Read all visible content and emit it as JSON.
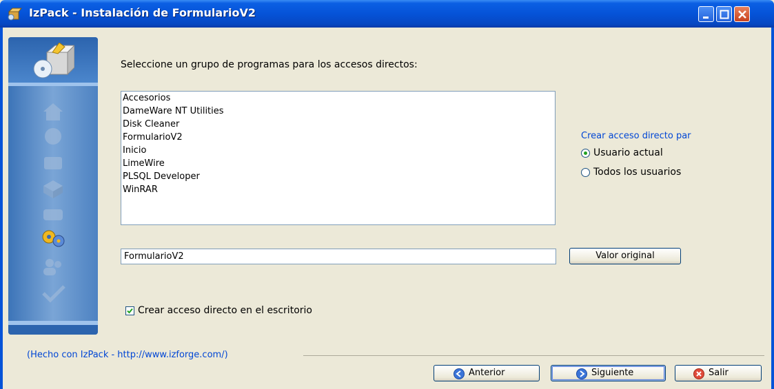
{
  "window": {
    "title": "IzPack - Instalación de FormularioV2",
    "icon": "setup-package-icon"
  },
  "main": {
    "prompt": "Seleccione un grupo de programas para los accesos directos:",
    "program_groups": [
      "Accesorios",
      "DameWare NT Utilities",
      "Disk Cleaner",
      "FormularioV2",
      "Inicio",
      "LimeWire",
      "PLSQL Developer",
      "WinRAR"
    ],
    "group_name_value": "FormularioV2",
    "default_button": "Valor original",
    "desktop_shortcut_label": "Crear acceso directo en el escritorio",
    "desktop_shortcut_checked": true
  },
  "shortcut_for": {
    "label": "Crear acceso directo par",
    "options": [
      {
        "label": "Usuario actual",
        "selected": true
      },
      {
        "label": "Todos los usuarios",
        "selected": false
      }
    ]
  },
  "footer": {
    "credit": "(Hecho con IzPack - http://www.izforge.com/)",
    "back_button": "Anterior",
    "next_button": "Siguiente",
    "quit_button": "Salir"
  },
  "colors": {
    "titlebar": "#0553d8",
    "link_text": "#0046d5",
    "window_bg": "#ece9d8"
  }
}
